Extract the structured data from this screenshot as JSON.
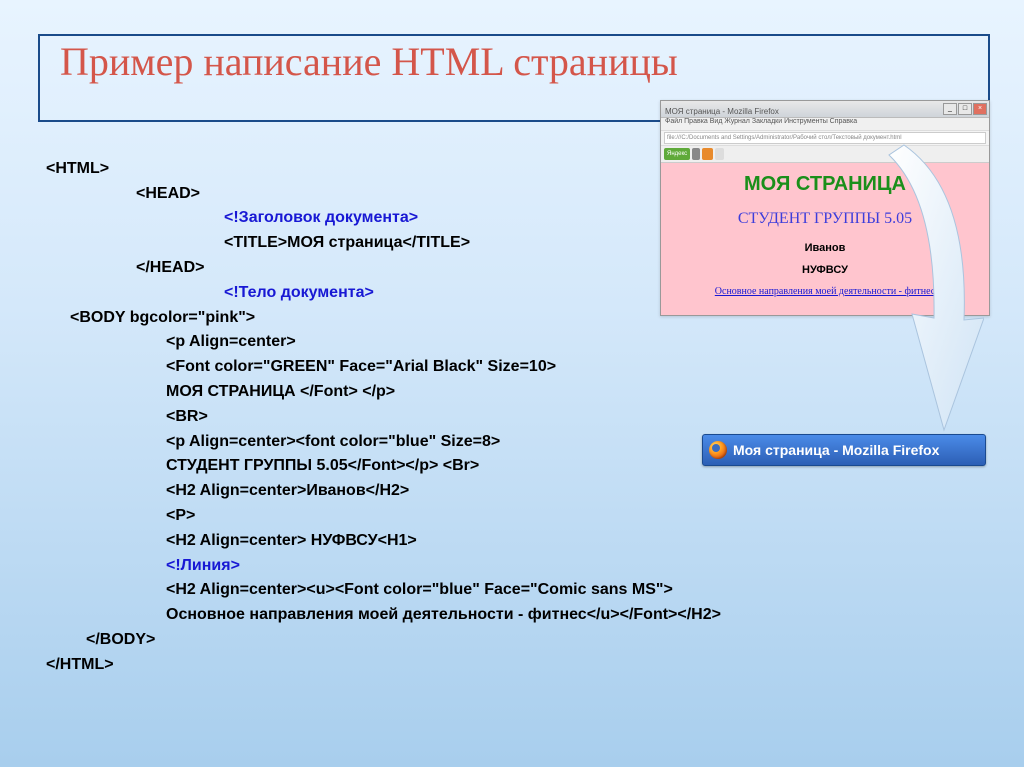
{
  "slide": {
    "title": "Пример написание HTML страницы"
  },
  "code": {
    "l1": "<HTML>",
    "l2": "<HEAD>",
    "l3": "<!Заголовок документа>",
    "l4": "<TITLE>МОЯ страница</TITLE>",
    "l5": "</HEAD>",
    "l6": "<!Тело документа>",
    "l7": "<BODY bgcolor=\"pink\">",
    "l8": "<p Align=center>",
    "l9": "<Font color=\"GREEN\" Face=\"Arial Black\" Size=10>",
    "l10": "МОЯ СТРАНИЦА </Font> </p>",
    "l11": "<BR>",
    "l12": "<p Align=center><font color=\"blue\" Size=8>",
    "l13": "СТУДЕНТ ГРУППЫ 5.05</Font></p> <Br>",
    "l14": "<H2 Align=center>Иванов</H2>",
    "l15": "<P>",
    "l16": "<H2 Align=center> НУФВСУ<H1>",
    "l17": "<!Линия>",
    "l18": "<H2 Align=center><u><Font color=\"blue\" Face=\"Comic sans MS\">",
    "l19": "Основное направления моей деятельности - фитнес</u></Font></H2>",
    "l20": "</BODY>",
    "l21": "</HTML>"
  },
  "preview": {
    "win_title": "МОЯ страница - Mozilla Firefox",
    "menu": "Файл  Правка  Вид  Журнал  Закладки  Инструменты  Справка",
    "addr": "file:///C:/Documents and Settings/Administrator/Рабочий стол/Текстовый документ.html",
    "title": "МОЯ СТРАНИЦА",
    "sub": "СТУДЕНТ ГРУППЫ 5.05",
    "h1": "Иванов",
    "h2": "НУФВСУ",
    "link": "Основное направления моей деятельности  -  фитнес"
  },
  "taskbar": {
    "label": "Моя страница - Mozilla Firefox"
  }
}
